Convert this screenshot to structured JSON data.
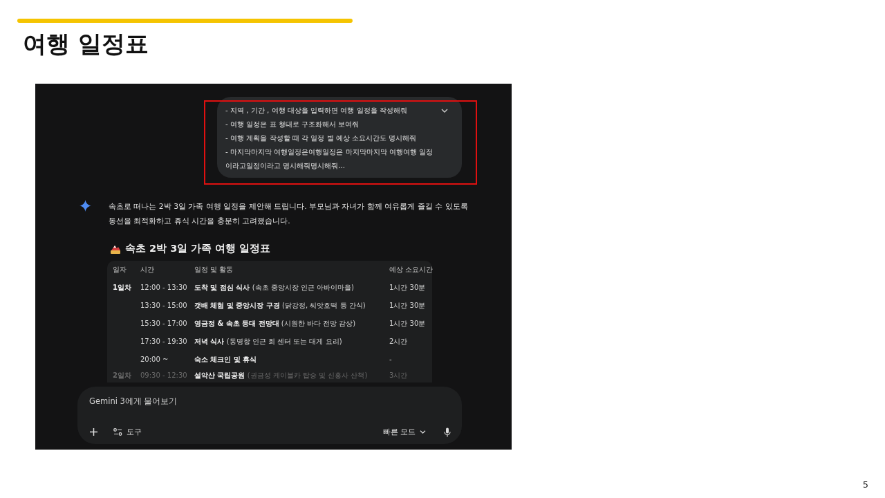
{
  "slide": {
    "title": "여행 일정표",
    "page_number": "5"
  },
  "prompt": {
    "lines": [
      "- 지역 , 기간 , 여행 대상을 입력하면 여행 일정을 작성해줘",
      "- 여행 일정은 표 형태로 구조화해서 보여줘",
      "- 여행 계획을 작성할 때 각 일정 별 예상 소요시간도 명시해줘",
      "- 마지막마지막 여행일정은여행일정은 마지막마지막 여행여행 일정이라고일정이라고 명시해줘명시해줘..."
    ]
  },
  "response": {
    "intro": "속초로 떠나는 2박 3일 가족 여행 일정을 제안해 드립니다. 부모님과 자녀가 함께 여유롭게 즐길 수 있도록 동선을 최적화하고 휴식 시간을 충분히 고려했습니다.",
    "heading": "속초 2박 3일 가족 여행 일정표",
    "table": {
      "columns": [
        "일자",
        "시간",
        "일정 및 활동",
        "예상 소요시간"
      ],
      "rows": [
        {
          "day": "1일차",
          "time": "12:00 - 13:30",
          "activity": "**도착 및 점심 식사** (속초 중앙시장 인근 아바이마을)",
          "duration": "1시간 30분",
          "faded": false
        },
        {
          "time": "13:30 - 15:00",
          "activity": "**갯배 체험 및 중앙시장 구경** (닭강정, 씨앗호떡 등 간식)",
          "duration": "1시간 30분",
          "faded": false
        },
        {
          "time": "15:30 - 17:00",
          "activity": "**영금정 & 속초 등대 전망대** (시원한 바다 전망 감상)",
          "duration": "1시간 30분",
          "faded": false
        },
        {
          "time": "17:30 - 19:30",
          "activity": "**저녁 식사** (동명항 인근 회 센터 또는 대게 요리)",
          "duration": "2시간",
          "faded": false
        },
        {
          "time": "20:00 ~",
          "activity": "**숙소 체크인 및 휴식**",
          "duration": "-",
          "faded": false
        },
        {
          "day": "2일차",
          "time": "09:30 - 12:30",
          "activity": "**설악산 국립공원** (권금성 케이블카 탑승 및 신흥사 산책)",
          "duration": "3시간",
          "faded": true
        }
      ]
    }
  },
  "input": {
    "placeholder": "Gemini 3에게 물어보기",
    "tools_label": "도구",
    "mode_label": "빠른 모드"
  }
}
